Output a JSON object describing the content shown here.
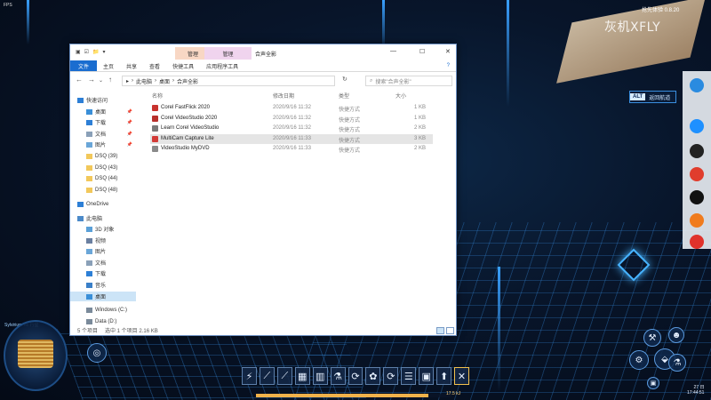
{
  "game": {
    "fps": "FPS",
    "watermark": "灰机XFLY",
    "beta": "抢先体验 0.8.20",
    "hud_alt_key": "ALT",
    "hud_alt_label": "返回航道",
    "planet_label": "Sylvirium rtc 行星",
    "energy_value": "17.5 kJ",
    "energy_fraction": 0.88,
    "clock_line1": "27 日",
    "clock_line2": "17:44:51",
    "hotbar": [
      "⚡",
      "⟋",
      "⟋",
      "▦",
      "▥",
      "⚗",
      "⟳",
      "✿",
      "⟳",
      "☰",
      "▣",
      "⬆",
      "✕"
    ]
  },
  "explorer": {
    "qat": [
      "▣",
      "☑",
      "📁",
      "▾"
    ],
    "ctx_tab1": "管理",
    "ctx_tab2": "管理",
    "title": "合声全影",
    "ribbon_tabs": [
      "文件",
      "主页",
      "共享",
      "查看",
      "快捷工具",
      "应用程序工具"
    ],
    "help": "?",
    "path": [
      "此电脑",
      "桌面",
      "合声全影"
    ],
    "search_placeholder": "搜索\"合声全影\"",
    "nav": [
      {
        "label": "快速访问",
        "icon": "star-icon"
      },
      {
        "label": "桌面",
        "icon": "desktop-icon",
        "pinned": true
      },
      {
        "label": "下载",
        "icon": "download-icon",
        "pinned": true
      },
      {
        "label": "文档",
        "icon": "documents-icon",
        "pinned": true
      },
      {
        "label": "图片",
        "icon": "pictures-icon",
        "pinned": true
      },
      {
        "label": "DSQ (39)",
        "icon": "folder-icon"
      },
      {
        "label": "DSQ (43)",
        "icon": "folder-icon"
      },
      {
        "label": "DSQ (44)",
        "icon": "folder-icon"
      },
      {
        "label": "DSQ (48)",
        "icon": "folder-icon"
      },
      {
        "label": "OneDrive",
        "icon": "cloud-icon"
      },
      {
        "label": "此电脑",
        "icon": "pc-icon"
      },
      {
        "label": "3D 对象",
        "icon": "cube-icon"
      },
      {
        "label": "视频",
        "icon": "video-icon"
      },
      {
        "label": "图片",
        "icon": "pictures-icon"
      },
      {
        "label": "文档",
        "icon": "documents-icon"
      },
      {
        "label": "下载",
        "icon": "download-icon"
      },
      {
        "label": "音乐",
        "icon": "music-icon"
      },
      {
        "label": "桌面",
        "icon": "desktop-icon"
      },
      {
        "label": "Windows (C:)",
        "icon": "drive-icon"
      },
      {
        "label": "Data (D:)",
        "icon": "drive-icon"
      }
    ],
    "columns": {
      "name": "名称",
      "date": "修改日期",
      "type": "类型",
      "size": "大小"
    },
    "files": [
      {
        "name": "Corel FastFlick 2020",
        "date": "2020/9/16 11:32",
        "type": "快捷方式",
        "size": "1 KB",
        "color": "#c8332e"
      },
      {
        "name": "Corel VideoStudio 2020",
        "date": "2020/9/16 11:32",
        "type": "快捷方式",
        "size": "1 KB",
        "color": "#b8302c"
      },
      {
        "name": "Learn Corel VideoStudio",
        "date": "2020/9/16 11:32",
        "type": "快捷方式",
        "size": "2 KB",
        "color": "#7a7a7a"
      },
      {
        "name": "MultiCam Capture Lite",
        "date": "2020/9/16 11:33",
        "type": "快捷方式",
        "size": "3 KB",
        "color": "#d23b37"
      },
      {
        "name": "VideoStudio MyDVD",
        "date": "2020/9/16 11:33",
        "type": "快捷方式",
        "size": "2 KB",
        "color": "#8a8a8a"
      }
    ],
    "selected_row": 3,
    "status_count": "5 个项目",
    "status_selected": "选中 1 个项目  2.16 KB"
  }
}
